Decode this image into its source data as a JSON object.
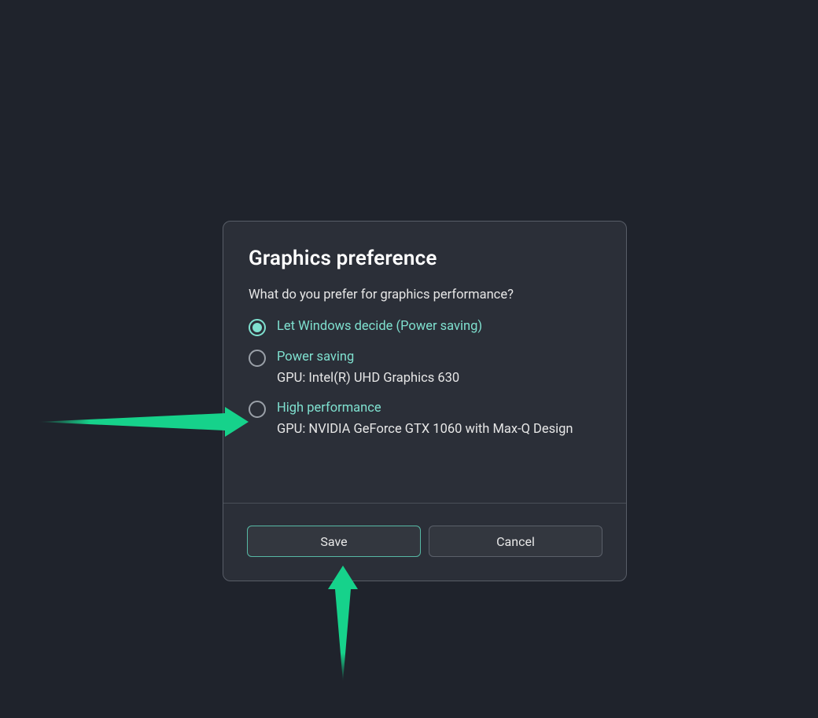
{
  "dialog": {
    "title": "Graphics preference",
    "question": "What do you prefer for graphics performance?",
    "options": [
      {
        "label": "Let Windows decide (Power saving)",
        "sub": "",
        "selected": true
      },
      {
        "label": "Power saving",
        "sub": "GPU: Intel(R) UHD Graphics 630",
        "selected": false
      },
      {
        "label": "High performance",
        "sub": "GPU: NVIDIA GeForce GTX 1060 with Max-Q Design",
        "selected": false
      }
    ],
    "buttons": {
      "save": "Save",
      "cancel": "Cancel"
    }
  }
}
